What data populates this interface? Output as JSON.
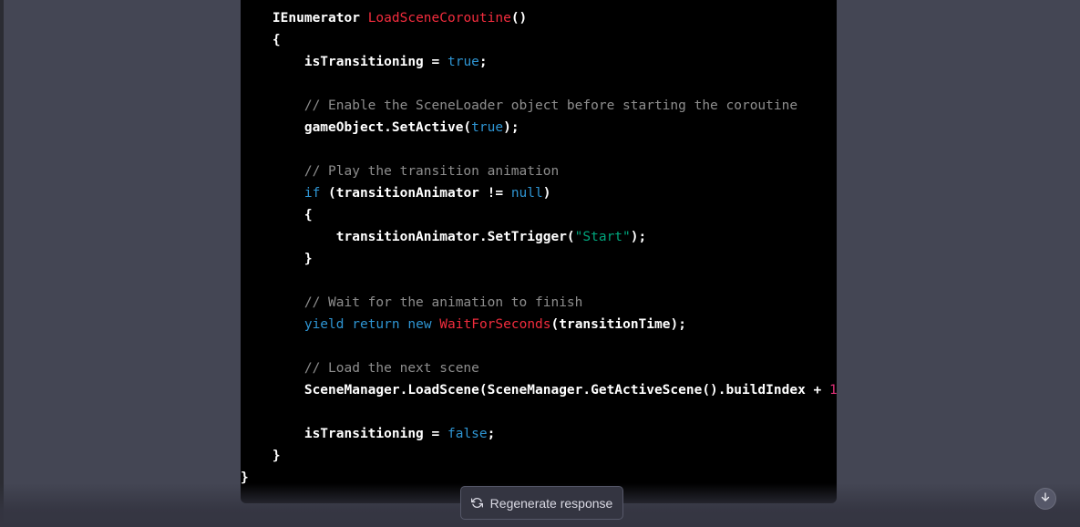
{
  "colors": {
    "page_background": "#444654",
    "code_background": "#000000",
    "keyword": "#2e95d3",
    "method": "#f22c3d",
    "string": "#00a67d",
    "comment": "#8e8e8e",
    "number": "#df3079"
  },
  "code": {
    "lines": [
      [
        {
          "t": "    IEnumerator ",
          "c": "plain"
        },
        {
          "t": "LoadSceneCoroutine",
          "c": "method"
        },
        {
          "t": "()",
          "c": "plain"
        }
      ],
      [
        {
          "t": "    {",
          "c": "plain"
        }
      ],
      [
        {
          "t": "        isTransitioning = ",
          "c": "plain"
        },
        {
          "t": "true",
          "c": "keyword"
        },
        {
          "t": ";",
          "c": "plain"
        }
      ],
      [
        {
          "t": "",
          "c": "plain"
        }
      ],
      [
        {
          "t": "        // Enable the SceneLoader object before starting the coroutine",
          "c": "comment"
        }
      ],
      [
        {
          "t": "        gameObject.SetActive(",
          "c": "plain"
        },
        {
          "t": "true",
          "c": "keyword"
        },
        {
          "t": ");",
          "c": "plain"
        }
      ],
      [
        {
          "t": "",
          "c": "plain"
        }
      ],
      [
        {
          "t": "        // Play the transition animation",
          "c": "comment"
        }
      ],
      [
        {
          "t": "        ",
          "c": "plain"
        },
        {
          "t": "if",
          "c": "keyword"
        },
        {
          "t": " (transitionAnimator != ",
          "c": "plain"
        },
        {
          "t": "null",
          "c": "keyword"
        },
        {
          "t": ")",
          "c": "plain"
        }
      ],
      [
        {
          "t": "        {",
          "c": "plain"
        }
      ],
      [
        {
          "t": "            transitionAnimator.SetTrigger(",
          "c": "plain"
        },
        {
          "t": "\"Start\"",
          "c": "string"
        },
        {
          "t": ");",
          "c": "plain"
        }
      ],
      [
        {
          "t": "        }",
          "c": "plain"
        }
      ],
      [
        {
          "t": "",
          "c": "plain"
        }
      ],
      [
        {
          "t": "        // Wait for the animation to finish",
          "c": "comment"
        }
      ],
      [
        {
          "t": "        ",
          "c": "plain"
        },
        {
          "t": "yield",
          "c": "keyword"
        },
        {
          "t": " ",
          "c": "plain"
        },
        {
          "t": "return",
          "c": "keyword"
        },
        {
          "t": " ",
          "c": "plain"
        },
        {
          "t": "new",
          "c": "keyword"
        },
        {
          "t": " ",
          "c": "plain"
        },
        {
          "t": "WaitForSeconds",
          "c": "method"
        },
        {
          "t": "(transitionTime);",
          "c": "plain"
        }
      ],
      [
        {
          "t": "",
          "c": "plain"
        }
      ],
      [
        {
          "t": "        // Load the next scene",
          "c": "comment"
        }
      ],
      [
        {
          "t": "        SceneManager.LoadScene(SceneManager.GetActiveScene().buildIndex + ",
          "c": "plain"
        },
        {
          "t": "1",
          "c": "number"
        },
        {
          "t": ")",
          "c": "plain"
        }
      ],
      [
        {
          "t": "",
          "c": "plain"
        }
      ],
      [
        {
          "t": "        isTransitioning = ",
          "c": "plain"
        },
        {
          "t": "false",
          "c": "keyword"
        },
        {
          "t": ";",
          "c": "plain"
        }
      ],
      [
        {
          "t": "    }",
          "c": "plain"
        }
      ],
      [
        {
          "t": "}",
          "c": "plain"
        }
      ]
    ]
  },
  "regenerate_button": {
    "label": "Regenerate response",
    "icon": "refresh-icon"
  },
  "scroll_button": {
    "icon": "arrow-down-icon"
  }
}
